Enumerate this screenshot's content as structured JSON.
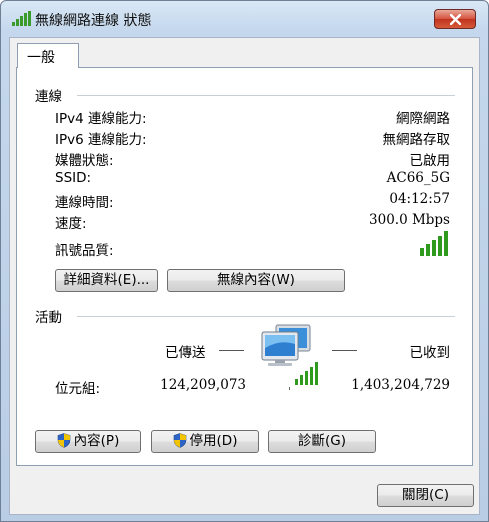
{
  "window": {
    "title": "無線網路連線 狀態"
  },
  "tabs": [
    {
      "label": "一般"
    }
  ],
  "connection": {
    "section_title": "連線",
    "rows": [
      {
        "label": "IPv4 連線能力:",
        "value": "網際網路"
      },
      {
        "label": "IPv6 連線能力:",
        "value": "無網路存取"
      },
      {
        "label": "媒體狀態:",
        "value": "已啟用"
      },
      {
        "label": "SSID:",
        "value": "AC66_5G"
      },
      {
        "label": "連線時間:",
        "value": "04:12:57"
      },
      {
        "label": "速度:",
        "value": "300.0 Mbps"
      }
    ],
    "signal_label": "訊號品質:",
    "signal_bars": 5,
    "details_button": "詳細資料(E)...",
    "wireless_props_button": "無線內容(W)"
  },
  "activity": {
    "section_title": "活動",
    "sent_label": "已傳送",
    "received_label": "已收到",
    "bytes_label": "位元組:",
    "bytes_sent": "124,209,073",
    "bytes_received": "1,403,204,729"
  },
  "buttons": {
    "properties": "內容(P)",
    "disable": "停用(D)",
    "diagnose": "診斷(G)",
    "close": "關閉(C)"
  },
  "colors": {
    "signal": "#2f9a1e",
    "close_button": "#c9412a"
  }
}
